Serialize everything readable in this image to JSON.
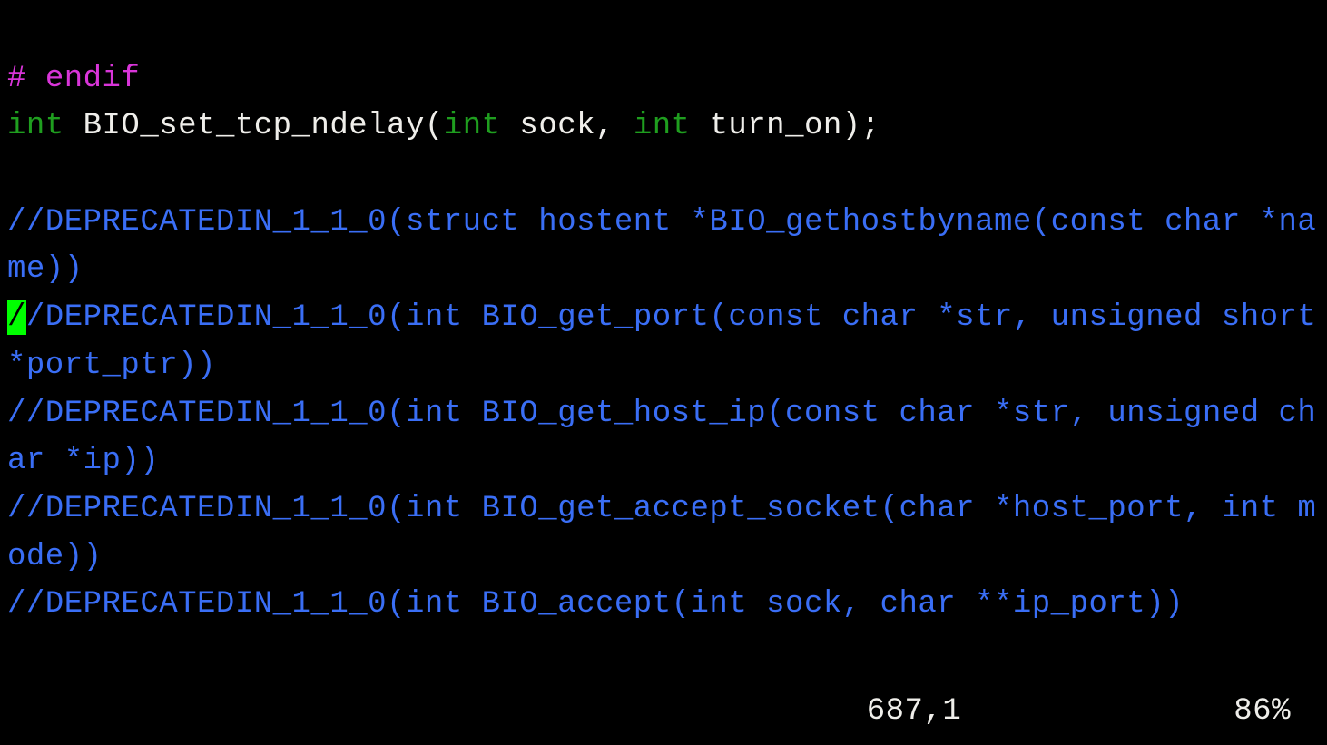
{
  "code_lines": {
    "l1_hash": "# ",
    "l1_endif": "endif",
    "l2_int_a": "int",
    "l2_mid_a": " BIO_set_tcp_ndelay(",
    "l2_int_b": "int",
    "l2_mid_b": " sock, ",
    "l2_int_c": "int",
    "l2_end": " turn_on);",
    "l3_blank": "",
    "l4_comment": "//DEPRECATEDIN_1_1_0(struct hostent *BIO_gethostbyname(const char *name))",
    "l5_cursor_char": "/",
    "l5_comment_rest": "/DEPRECATEDIN_1_1_0(int BIO_get_port(const char *str, unsigned short *port_ptr))",
    "l6_comment": "//DEPRECATEDIN_1_1_0(int BIO_get_host_ip(const char *str, unsigned char *ip))",
    "l7_comment": "//DEPRECATEDIN_1_1_0(int BIO_get_accept_socket(char *host_port, int mode))",
    "l8_comment": "//DEPRECATEDIN_1_1_0(int BIO_accept(int sock, char **ip_port))"
  },
  "status": {
    "position": "687,1",
    "percent": "86%"
  }
}
